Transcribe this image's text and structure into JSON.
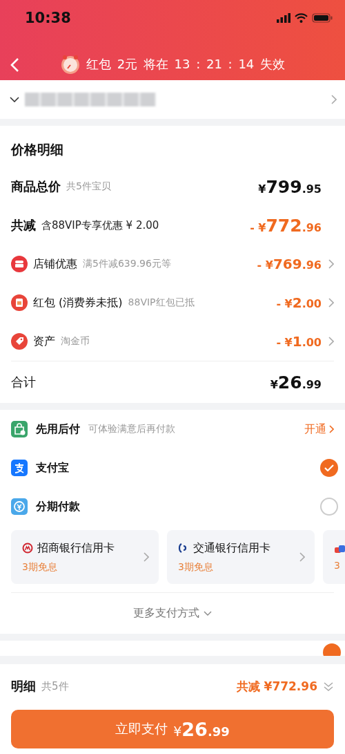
{
  "status_bar": {
    "time": "10:38"
  },
  "nav": {
    "parts": [
      "红包",
      "2元",
      "将在",
      "13 : 21 : 14",
      "失效"
    ]
  },
  "price_details": {
    "title": "价格明细",
    "total": {
      "label": "商品总价",
      "note": "共5件宝贝",
      "amount": {
        "prefix": "¥",
        "whole": "799",
        "cents": ".95"
      }
    },
    "discount": {
      "label": "共减",
      "note": "含88VIP专享优惠 ¥ 2.00",
      "amount": {
        "prefix": "- ¥",
        "whole": "772",
        "cents": ".96"
      }
    },
    "items": [
      {
        "kind": "store",
        "label": "店铺优惠",
        "note": "满5件减639.96元等",
        "amount": {
          "prefix": "- ¥",
          "whole": "769",
          "cents": ".96"
        }
      },
      {
        "kind": "redpacket",
        "label": "红包 (消费券未抵)",
        "note": "88VIP红包已抵",
        "amount": {
          "prefix": "- ¥",
          "whole": "2",
          "cents": ".00"
        }
      },
      {
        "kind": "asset",
        "label": "资产",
        "note": "淘金币",
        "amount": {
          "prefix": "- ¥",
          "whole": "1",
          "cents": ".00"
        }
      }
    ],
    "sum": {
      "label": "合计",
      "amount": {
        "prefix": "¥",
        "whole": "26",
        "cents": ".99"
      }
    }
  },
  "pay_later": {
    "label": "先用后付",
    "note": "可体验满意后再付款",
    "action": "开通"
  },
  "payment_options": [
    {
      "kind": "alipay",
      "label": "支付宝",
      "selected": true
    },
    {
      "kind": "installment",
      "label": "分期付款",
      "selected": false
    }
  ],
  "bank_cards": [
    {
      "kind": "cmb",
      "name": "招商银行信用卡",
      "offer": "3期免息"
    },
    {
      "kind": "bocom",
      "name": "交通银行信用卡",
      "offer": "3期免息"
    },
    {
      "kind": "other",
      "offer": "3"
    }
  ],
  "hidden_option": {
    "selected": true
  },
  "more_methods": "更多支付方式",
  "footer": {
    "label": "明细",
    "count": "共5件",
    "saving": "共减 ¥772.96",
    "pay_button": {
      "label": "立即支付",
      "amount": {
        "prefix": "¥",
        "whole": "26",
        "cents": ".99"
      }
    }
  }
}
